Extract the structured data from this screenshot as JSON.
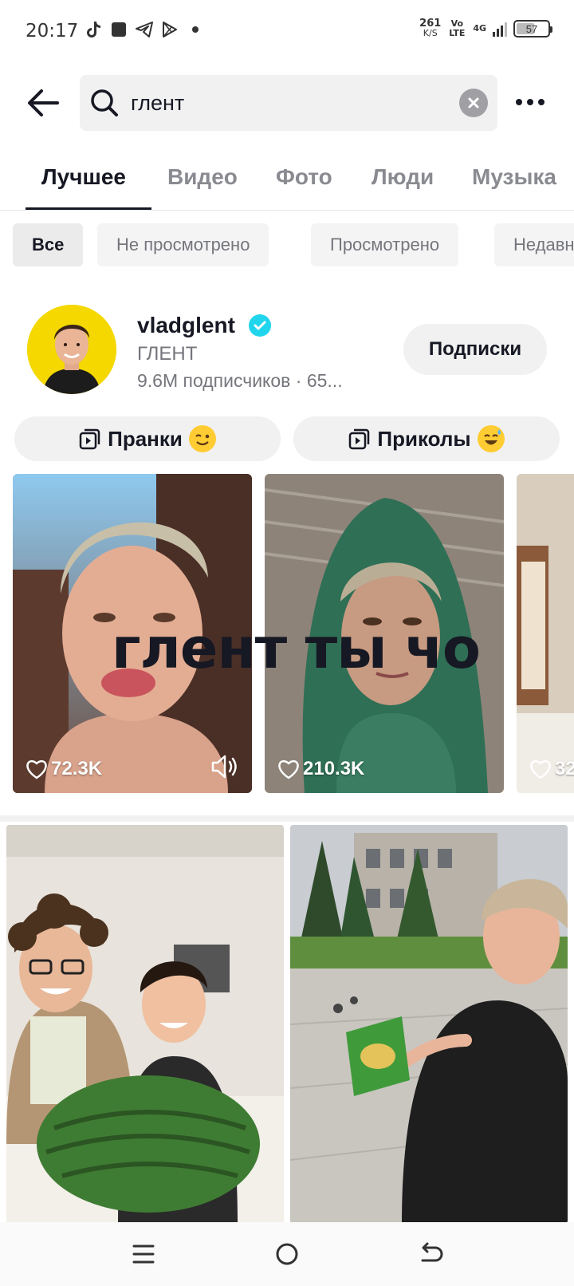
{
  "status_bar": {
    "time": "20:17",
    "notification_icons": [
      "tiktok-icon",
      "app-square-icon",
      "telegram-icon",
      "play-store-icon",
      "dot-icon"
    ],
    "net_speed_value": "261",
    "net_speed_unit": "K/S",
    "volte": "Vo LTE",
    "network": "4G",
    "battery": "57",
    "battery_level": 0.57
  },
  "search": {
    "query": "глент",
    "back_icon": "arrow-left-icon",
    "search_icon": "search-icon",
    "clear_icon": "clear-icon",
    "more_icon": "more-icon"
  },
  "tabs": [
    {
      "label": "Лучшее",
      "active": true
    },
    {
      "label": "Видео"
    },
    {
      "label": "Фото"
    },
    {
      "label": "Люди"
    },
    {
      "label": "Музыка"
    }
  ],
  "filters": [
    "Все",
    "Не просмотрено",
    "Просмотрено",
    "Недавно"
  ],
  "user": {
    "username": "vladglent",
    "nickname": "ГЛЕНТ",
    "stats": "9.6M подписчиков · 65...",
    "button": "Подписки",
    "verified_icon": "verified-icon"
  },
  "playlists": [
    {
      "label": "Пранки",
      "icon": "playlist-icon",
      "emoji": "wink-emoji"
    },
    {
      "label": "Приколы",
      "icon": "playlist-icon",
      "emoji": "sweat-smile-emoji"
    }
  ],
  "videos": [
    {
      "likes": "72.3K",
      "has_sound_icon": true
    },
    {
      "likes": "210.3K"
    },
    {
      "likes": "32"
    }
  ],
  "overlay_caption": "глент ты чо",
  "colors": {
    "accent": "#161823",
    "verified": "#20d5ec",
    "avatar_bg": "#f4d800",
    "muted": "#8a8b91"
  },
  "navbar": {
    "icons": [
      "menu-icon",
      "home-circle-icon",
      "back-icon"
    ]
  }
}
